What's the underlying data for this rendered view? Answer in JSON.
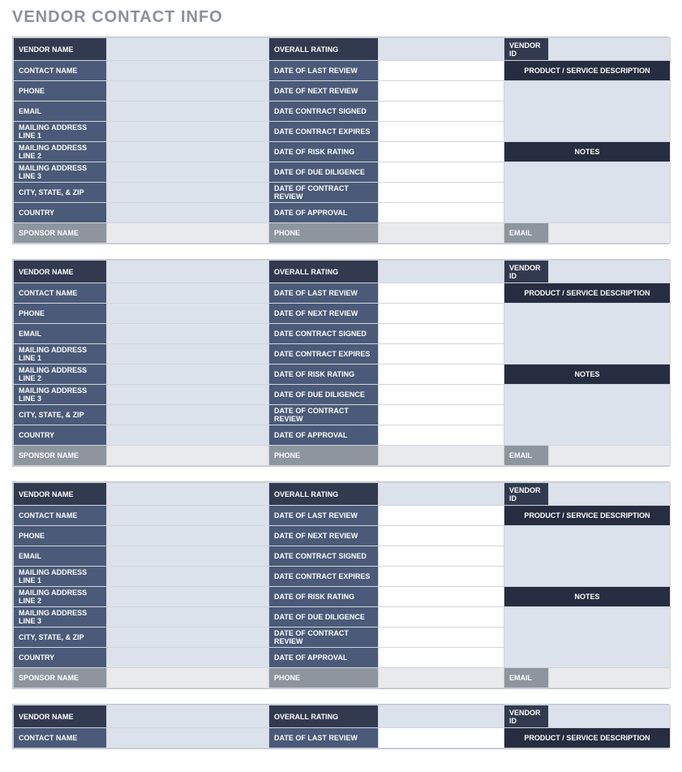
{
  "title": "VENDOR CONTACT INFO",
  "labels": {
    "vendor_name": "VENDOR NAME",
    "overall_rating": "OVERALL RATING",
    "vendor_id": "VENDOR ID",
    "contact_name": "CONTACT NAME",
    "phone": "PHONE",
    "email": "EMAIL",
    "mailing1": "MAILING ADDRESS LINE 1",
    "mailing2": "MAILING ADDRESS LINE 2",
    "mailing3": "MAILING ADDRESS LINE 3",
    "city_state_zip": "CITY, STATE, & ZIP",
    "country": "COUNTRY",
    "sponsor_name": "SPONSOR NAME",
    "date_last_review": "DATE OF LAST REVIEW",
    "date_next_review": "DATE OF NEXT REVIEW",
    "date_contract_signed": "DATE CONTRACT SIGNED",
    "date_contract_expires": "DATE CONTRACT EXPIRES",
    "date_risk_rating": "DATE OF RISK RATING",
    "date_due_diligence": "DATE OF DUE DILIGENCE",
    "date_contract_review": "DATE OF CONTRACT REVIEW",
    "date_approval": "DATE OF APPROVAL",
    "product_service_desc": "PRODUCT / SERVICE DESCRIPTION",
    "notes": "NOTES"
  },
  "vendors": [
    {
      "vendor_name": "",
      "overall_rating": "",
      "vendor_id": "",
      "contact_name": "",
      "phone": "",
      "email": "",
      "mailing1": "",
      "mailing2": "",
      "mailing3": "",
      "city_state_zip": "",
      "country": "",
      "sponsor_name": "",
      "date_last_review": "",
      "date_next_review": "",
      "date_contract_signed": "",
      "date_contract_expires": "",
      "date_risk_rating": "",
      "date_due_diligence": "",
      "date_contract_review": "",
      "date_approval": "",
      "product_service_desc": "",
      "notes": "",
      "sponsor_phone": "",
      "sponsor_email": ""
    },
    {
      "vendor_name": "",
      "overall_rating": "",
      "vendor_id": "",
      "contact_name": "",
      "phone": "",
      "email": "",
      "mailing1": "",
      "mailing2": "",
      "mailing3": "",
      "city_state_zip": "",
      "country": "",
      "sponsor_name": "",
      "date_last_review": "",
      "date_next_review": "",
      "date_contract_signed": "",
      "date_contract_expires": "",
      "date_risk_rating": "",
      "date_due_diligence": "",
      "date_contract_review": "",
      "date_approval": "",
      "product_service_desc": "",
      "notes": "",
      "sponsor_phone": "",
      "sponsor_email": ""
    },
    {
      "vendor_name": "",
      "overall_rating": "",
      "vendor_id": "",
      "contact_name": "",
      "phone": "",
      "email": "",
      "mailing1": "",
      "mailing2": "",
      "mailing3": "",
      "city_state_zip": "",
      "country": "",
      "sponsor_name": "",
      "date_last_review": "",
      "date_next_review": "",
      "date_contract_signed": "",
      "date_contract_expires": "",
      "date_risk_rating": "",
      "date_due_diligence": "",
      "date_contract_review": "",
      "date_approval": "",
      "product_service_desc": "",
      "notes": "",
      "sponsor_phone": "",
      "sponsor_email": ""
    },
    {
      "vendor_name": "",
      "overall_rating": "",
      "vendor_id": "",
      "contact_name": "",
      "phone": "",
      "email": "",
      "mailing1": "",
      "mailing2": "",
      "mailing3": "",
      "city_state_zip": "",
      "country": "",
      "sponsor_name": "",
      "date_last_review": "",
      "date_next_review": "",
      "date_contract_signed": "",
      "date_contract_expires": "",
      "date_risk_rating": "",
      "date_due_diligence": "",
      "date_contract_review": "",
      "date_approval": "",
      "product_service_desc": "",
      "notes": "",
      "sponsor_phone": "",
      "sponsor_email": ""
    }
  ]
}
